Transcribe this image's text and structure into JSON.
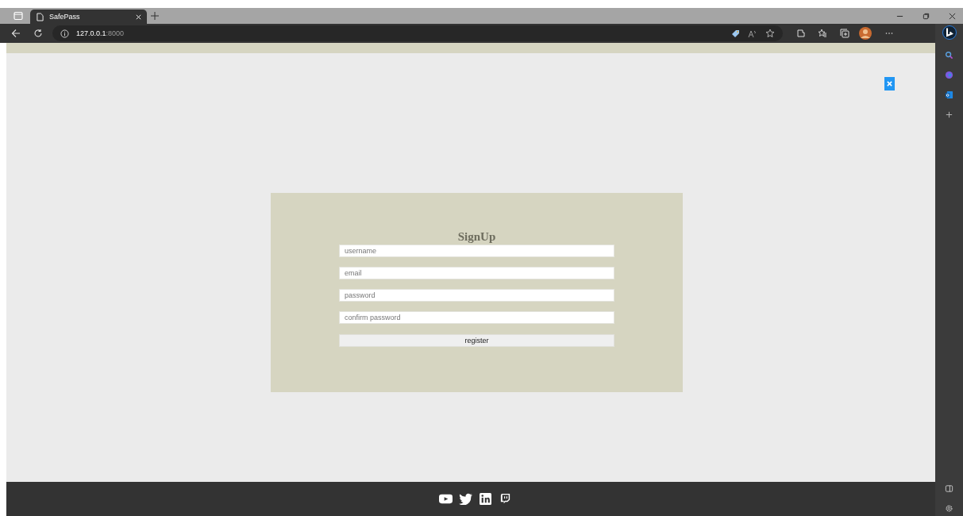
{
  "browser": {
    "tabs": [
      {
        "title": "SafePass",
        "selected": true
      }
    ],
    "address": {
      "host": "127.0.0.1",
      "port": ":8000"
    }
  },
  "page": {
    "signup": {
      "title": "SignUp",
      "fields": [
        {
          "placeholder": "username"
        },
        {
          "placeholder": "email"
        },
        {
          "placeholder": "password"
        },
        {
          "placeholder": "confirm password"
        }
      ],
      "button": "register"
    }
  }
}
